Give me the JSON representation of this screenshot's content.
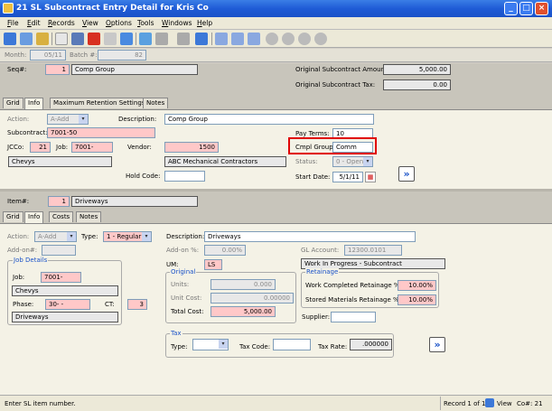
{
  "window": {
    "title": "21 SL Subcontract Entry Detail for Kris Co"
  },
  "menu": [
    "File",
    "Edit",
    "Records",
    "View",
    "Options",
    "Tools",
    "Windows",
    "Help"
  ],
  "header": {
    "month_label": "Month:",
    "month": "05/11",
    "batch_label": "Batch #:",
    "batch": "82",
    "seq_label": "Seq#:",
    "seq": "1",
    "seq_desc": "Comp Group",
    "orig_amount_label": "Original Subcontract Amount:",
    "orig_amount": "5,000.00",
    "orig_tax_label": "Original Subcontract Tax:",
    "orig_tax": "0.00"
  },
  "top_tabs": [
    "Grid",
    "Info",
    "Maximum Retention Settings",
    "Notes"
  ],
  "info": {
    "action_label": "Action:",
    "action": "A-Add",
    "desc_label": "Description:",
    "desc": "Comp Group",
    "subcontract_label": "Subcontract:",
    "subcontract": "7001-50",
    "pay_terms_label": "Pay Terms:",
    "pay_terms": "10",
    "jcco_label": "JCCo:",
    "jcco": "21",
    "job_label": "Job:",
    "job": "7001-",
    "vendor_label": "Vendor:",
    "vendor": "1500",
    "cmpl_group_label": "Cmpl Group:",
    "cmpl_group": "Comm",
    "job_name": "Chevys",
    "vendor_name": "ABC Mechanical Contractors",
    "status_label": "Status:",
    "status": "0 - Open",
    "hold_code_label": "Hold Code:",
    "start_date_label": "Start Date:",
    "start_date": "5/1/11"
  },
  "item": {
    "item_label": "Item#:",
    "item_no": "1",
    "item_desc": "Driveways",
    "tabs": [
      "Grid",
      "Info",
      "Costs",
      "Notes"
    ],
    "action_label": "Action:",
    "action": "A-Add",
    "type_label": "Type:",
    "type": "1 - Regular",
    "desc_label": "Description:",
    "desc": "Driveways",
    "addon_label": "Add-on#:",
    "addon_pct_label": "Add-on %:",
    "addon_pct": "0.00%",
    "gl_label": "GL Account:",
    "gl": "12300.0101",
    "um_label": "UM:",
    "um": "LS",
    "gl_desc": "Work In Progress - Subcontract",
    "job_details_title": "Job Details",
    "job_label": "Job:",
    "job": "7001-",
    "job_name": "Chevys",
    "phase_label": "Phase:",
    "phase": "30-  -",
    "ct_label": "CT:",
    "ct": "3",
    "phase_desc": "Driveways",
    "original_title": "Original",
    "units_label": "Units:",
    "units": "0.000",
    "unit_cost_label": "Unit Cost:",
    "unit_cost": "0.00000",
    "total_cost_label": "Total Cost:",
    "total_cost": "5,000.00",
    "retainage_title": "Retainage",
    "wc_ret_label": "Work Completed Retainage %:",
    "wc_ret": "10.00%",
    "sm_ret_label": "Stored Materials Retainage %:",
    "sm_ret": "10.00%",
    "supplier_label": "Supplier:",
    "tax_title": "Tax",
    "tax_type_label": "Type:",
    "tax_code_label": "Tax Code:",
    "tax_rate_label": "Tax Rate:",
    "tax_rate": ".000000"
  },
  "status": {
    "message": "Enter SL item number.",
    "record": "Record 1 of 1",
    "view": "View",
    "co": "Co#: 21"
  },
  "colors": {
    "highlight": "#e00000",
    "required": "#ffc8c8",
    "title": "#1f5bd6"
  }
}
